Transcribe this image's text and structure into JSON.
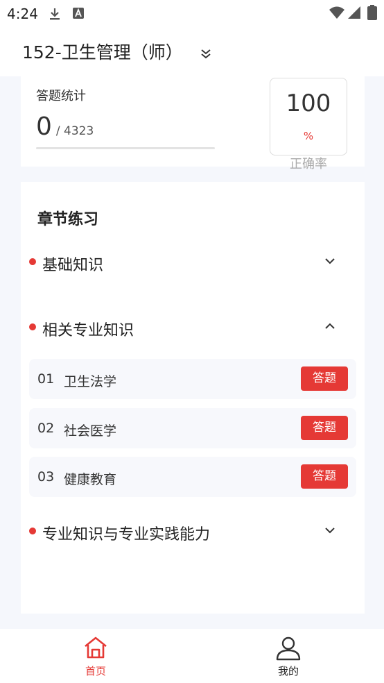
{
  "status_bar": {
    "time": "4:24"
  },
  "header": {
    "title": "152-卫生管理（师）"
  },
  "stats": {
    "label": "答题统计",
    "answered": "0",
    "total": "/ 4323",
    "accuracy": {
      "value": "100",
      "unit": "%",
      "label": "正确率"
    }
  },
  "chapters": {
    "title": "章节练习",
    "sections": [
      {
        "label": "基础知识",
        "expanded": false
      },
      {
        "label": "相关专业知识",
        "expanded": true,
        "items": [
          {
            "num": "01",
            "label": "卫生法学",
            "button": "答题"
          },
          {
            "num": "02",
            "label": "社会医学",
            "button": "答题"
          },
          {
            "num": "03",
            "label": "健康教育",
            "button": "答题"
          }
        ]
      },
      {
        "label": "专业知识与专业实践能力",
        "expanded": false
      }
    ]
  },
  "tabbar": {
    "tabs": [
      {
        "label": "首页",
        "icon": "home-icon",
        "active": true
      },
      {
        "label": "我的",
        "icon": "user-icon",
        "active": false
      }
    ]
  },
  "colors": {
    "accent": "#e53935",
    "background": "#f5f7fc",
    "card": "#ffffff"
  }
}
